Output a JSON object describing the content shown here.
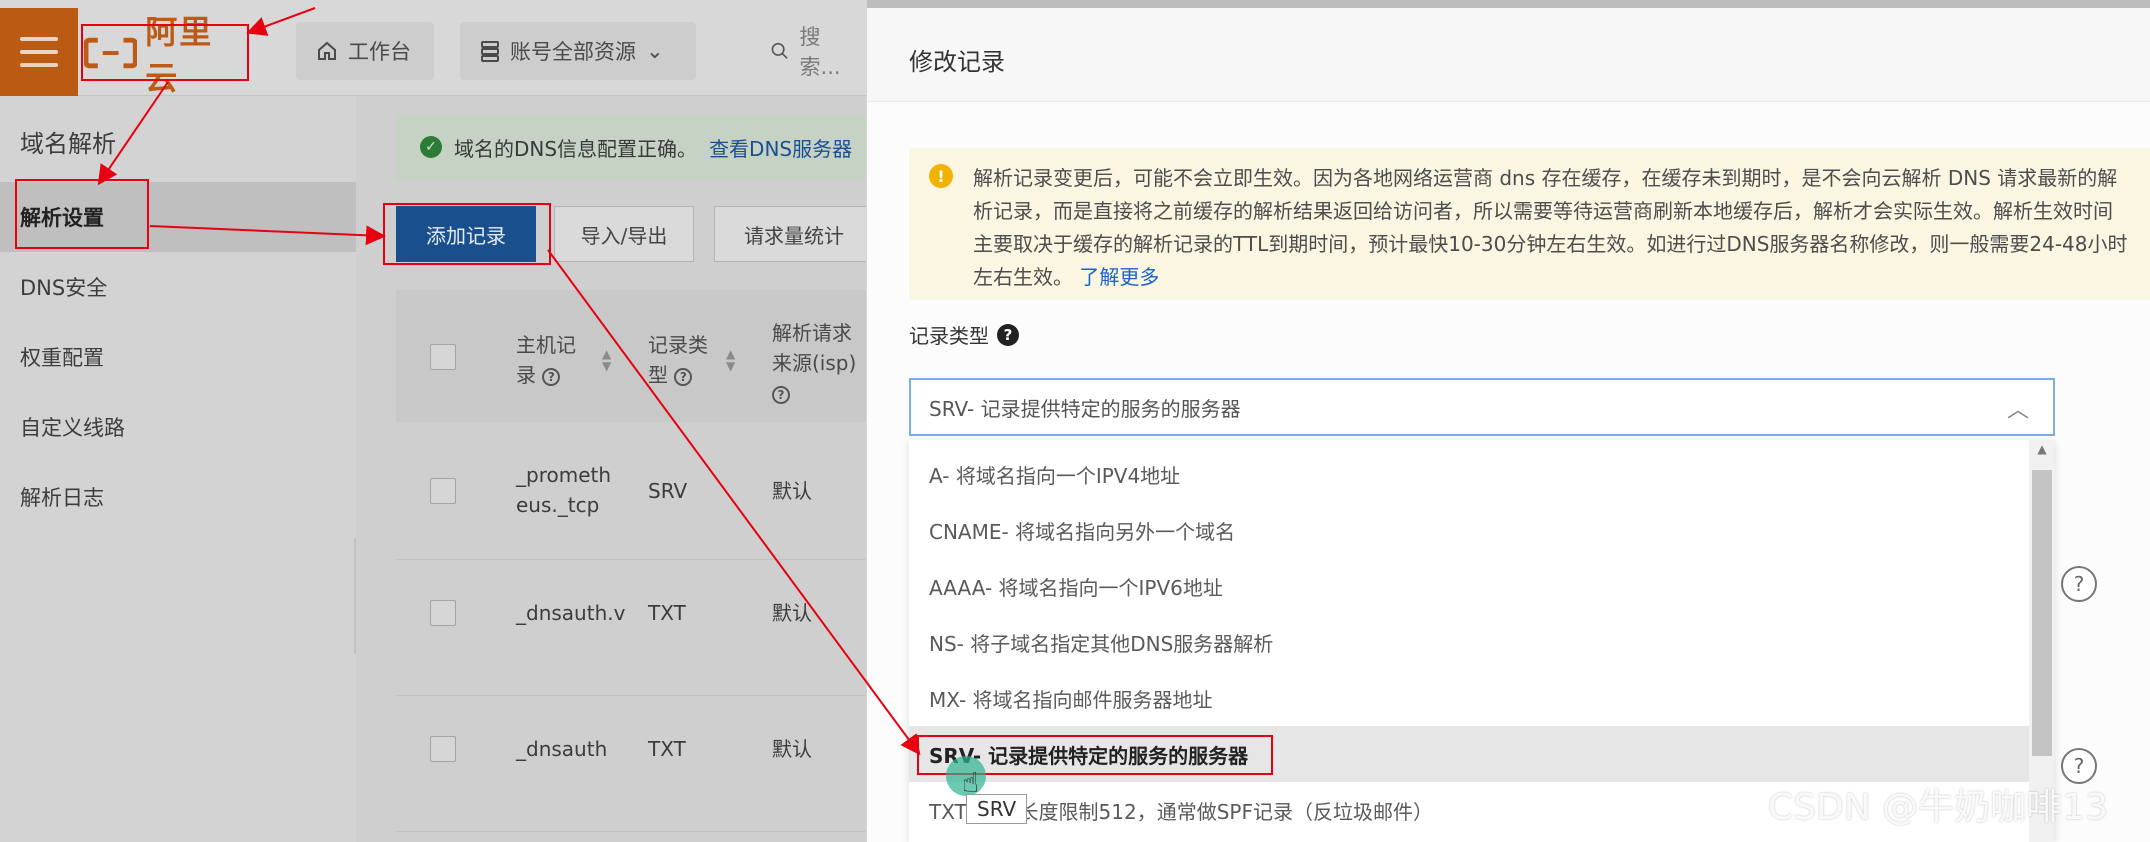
{
  "topbar": {
    "logo_text": "阿里云",
    "workbench_label": "工作台",
    "resources_label": "账号全部资源",
    "search_placeholder": "搜索..."
  },
  "sidebar": {
    "title": "域名解析",
    "items": [
      {
        "label": "解析设置",
        "active": true
      },
      {
        "label": "DNS安全",
        "active": false
      },
      {
        "label": "权重配置",
        "active": false
      },
      {
        "label": "自定义线路",
        "active": false
      },
      {
        "label": "解析日志",
        "active": false
      }
    ]
  },
  "main": {
    "dns_message": "域名的DNS信息配置正确。",
    "dns_link": "查看DNS服务器",
    "buttons": {
      "add": "添加记录",
      "import_export": "导入/导出",
      "stats": "请求量统计"
    },
    "table": {
      "headers": {
        "host": "主机记录",
        "type": "记录类型",
        "isp": "解析请求来源(isp)"
      },
      "rows": [
        {
          "host": "_prometheus._tcp",
          "type": "SRV",
          "isp": "默认"
        },
        {
          "host": "_dnsauth.v",
          "type": "TXT",
          "isp": "默认"
        },
        {
          "host": "_dnsauth",
          "type": "TXT",
          "isp": "默认"
        }
      ]
    }
  },
  "panel": {
    "title": "修改记录",
    "warning": "解析记录变更后，可能不会立即生效。因为各地网络运营商 dns 存在缓存，在缓存未到期时，是不会向云解析 DNS 请求最新的解析记录，而是直接将之前缓存的解析结果返回给访问者，所以需要等待运营商刷新本地缓存后，解析才会实际生效。解析生效时间主要取决于缓存的解析记录的TTL到期时间，预计最快10-30分钟左右生效。如进行过DNS服务器名称修改，则一般需要24-48小时左右生效。",
    "learn_more": "了解更多",
    "record_type_label": "记录类型",
    "record_type_selected": "SRV- 记录提供特定的服务的服务器",
    "options": [
      "A- 将域名指向一个IPV4地址",
      "CNAME- 将域名指向另外一个域名",
      "AAAA- 将域名指向一个IPV6地址",
      "NS- 将子域名指定其他DNS服务器解析",
      "MX- 将域名指向邮件服务器地址",
      "SRV- 记录提供特定的服务的服务器",
      "TXT- 文本长度限制512，通常做SPF记录（反垃圾邮件）"
    ],
    "active_option_index": 5
  },
  "overlay": {
    "tooltip": "SRV",
    "watermark": "CSDN @牛奶咖啡13"
  }
}
